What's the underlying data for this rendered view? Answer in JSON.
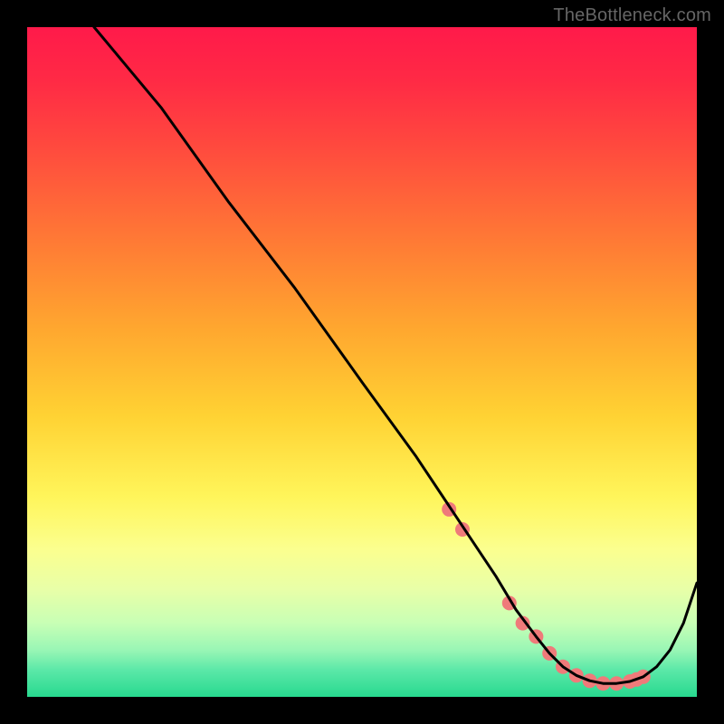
{
  "watermark": "TheBottleneck.com",
  "chart_data": {
    "type": "line",
    "title": "",
    "xlabel": "",
    "ylabel": "",
    "xlim": [
      0,
      100
    ],
    "ylim": [
      0,
      100
    ],
    "series": [
      {
        "name": "curve",
        "x": [
          10,
          15,
          20,
          30,
          40,
          50,
          58,
          62,
          66,
          70,
          73,
          76,
          78,
          80,
          82,
          84,
          86,
          88,
          90,
          92,
          94,
          96,
          98,
          100
        ],
        "y": [
          100,
          94,
          88,
          74,
          61,
          47,
          36,
          30,
          24,
          18,
          13,
          9,
          6.5,
          4.5,
          3.2,
          2.4,
          2,
          2,
          2.3,
          3,
          4.5,
          7,
          11,
          17
        ]
      }
    ],
    "markers": {
      "name": "highlight-dots",
      "color": "#ef7a7a",
      "x": [
        63,
        65,
        72,
        74,
        76,
        78,
        80,
        82,
        84,
        86,
        88,
        90,
        91,
        92
      ],
      "y": [
        28,
        25,
        14,
        11,
        9,
        6.5,
        4.5,
        3.2,
        2.4,
        2,
        2,
        2.3,
        2.6,
        3
      ]
    }
  }
}
